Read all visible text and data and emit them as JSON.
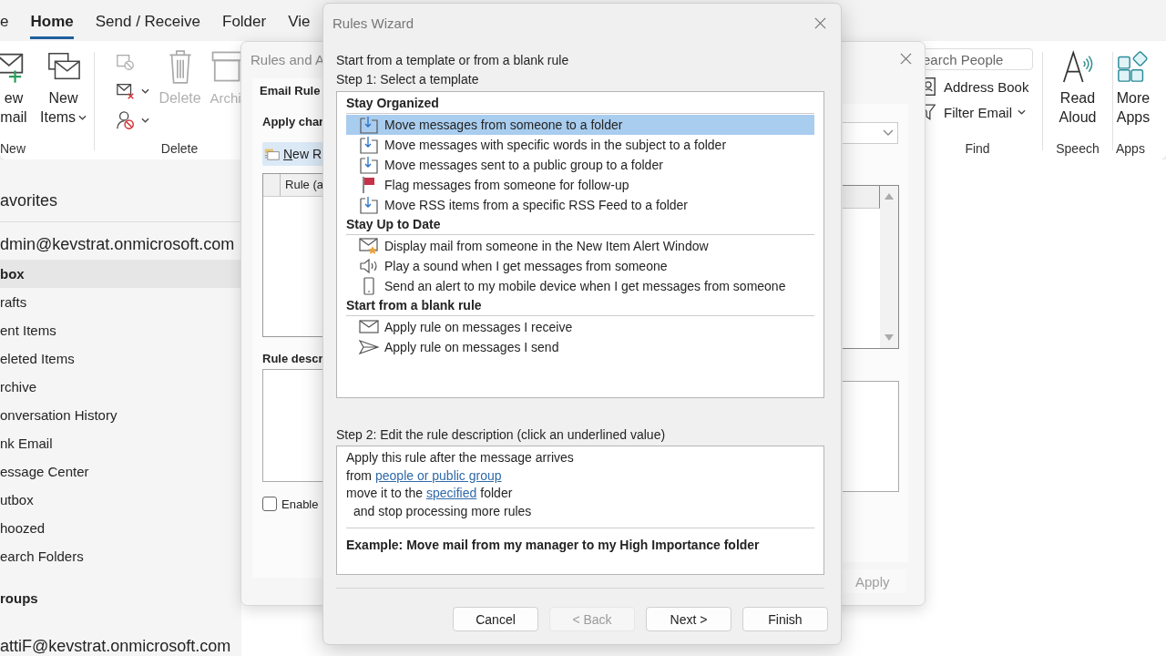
{
  "ribbon": {
    "tabs": [
      {
        "label": "e",
        "selected": false
      },
      {
        "label": "Home",
        "selected": true
      },
      {
        "label": "Send / Receive",
        "selected": false
      },
      {
        "label": "Folder",
        "selected": false
      },
      {
        "label": "Vie",
        "selected": false
      }
    ],
    "new_group": {
      "label": "New",
      "new_email": [
        "ew",
        "mail"
      ],
      "new_items": [
        "New",
        "Items"
      ]
    },
    "delete_group": {
      "label": "Delete",
      "delete": {
        "label": "Delete",
        "disabled": true
      },
      "archive": {
        "label": "Archi",
        "disabled": true
      }
    },
    "find_group": {
      "label": "Find",
      "search_placeholder": "earch People",
      "address_book": "Address Book",
      "filter_email": "Filter Email"
    },
    "speech_group": {
      "label": "Speech",
      "read_aloud": [
        "Read",
        "Aloud"
      ]
    },
    "apps_group": {
      "label": "Apps",
      "more_apps": [
        "More",
        "Apps"
      ]
    }
  },
  "navigation": {
    "favorites": "avorites",
    "account": "dmin@kevstrat.onmicrosoft.com",
    "folders": [
      {
        "label": "box",
        "selected": true
      },
      {
        "label": "rafts",
        "selected": false
      },
      {
        "label": "ent Items",
        "selected": false
      },
      {
        "label": "eleted Items",
        "selected": false
      },
      {
        "label": "rchive",
        "selected": false
      },
      {
        "label": "onversation History",
        "selected": false
      },
      {
        "label": "nk Email",
        "selected": false
      },
      {
        "label": "essage Center",
        "selected": false
      },
      {
        "label": "utbox",
        "selected": false
      },
      {
        "label": "hoozed",
        "selected": false
      },
      {
        "label": "earch Folders",
        "selected": false
      }
    ],
    "groups": "roups",
    "second_account": "attiF@kevstrat.onmicrosoft.com"
  },
  "rules_and_alerts": {
    "title": "Rules and A",
    "tab": "Email Rule",
    "apply_changes_label": "Apply char",
    "new_rule_button": "New R",
    "column_header": "Rule (a",
    "description_label": "Rule descr",
    "enable_checkbox": {
      "label": "Enable",
      "checked": false
    },
    "apply_button": {
      "label": "Apply",
      "disabled": true
    }
  },
  "rules_wizard": {
    "title": "Rules Wizard",
    "intro": "Start from a template or from a blank rule",
    "step1": "Step 1: Select a template",
    "template_groups": [
      {
        "heading": "Stay Organized",
        "items": [
          {
            "kind": "move",
            "label": "Move messages from someone to a folder",
            "selected": true
          },
          {
            "kind": "move",
            "label": "Move messages with specific words in the subject to a folder",
            "selected": false
          },
          {
            "kind": "move",
            "label": "Move messages sent to a public group to a folder",
            "selected": false
          },
          {
            "kind": "flag",
            "label": "Flag messages from someone for follow-up",
            "selected": false
          },
          {
            "kind": "move",
            "label": "Move RSS items from a specific RSS Feed to a folder",
            "selected": false
          }
        ]
      },
      {
        "heading": "Stay Up to Date",
        "items": [
          {
            "kind": "alert",
            "label": "Display mail from someone in the New Item Alert Window",
            "selected": false
          },
          {
            "kind": "sound",
            "label": "Play a sound when I get messages from someone",
            "selected": false
          },
          {
            "kind": "mobile",
            "label": "Send an alert to my mobile device when I get messages from someone",
            "selected": false
          }
        ]
      },
      {
        "heading": "Start from a blank rule",
        "items": [
          {
            "kind": "receive",
            "label": "Apply rule on messages I receive",
            "selected": false
          },
          {
            "kind": "send",
            "label": "Apply rule on messages I send",
            "selected": false
          }
        ]
      }
    ],
    "step2": "Step 2: Edit the rule description (click an underlined value)",
    "description_lines": [
      {
        "indented": false,
        "parts": [
          {
            "text": "Apply this rule after the message arrives",
            "link": false
          }
        ]
      },
      {
        "indented": false,
        "parts": [
          {
            "text": "from",
            "link": false
          },
          {
            "text": "people or public group",
            "link": true
          }
        ]
      },
      {
        "indented": false,
        "parts": [
          {
            "text": "move it to the",
            "link": false
          },
          {
            "text": "specified",
            "link": true
          },
          {
            "text": "folder",
            "link": false
          }
        ]
      },
      {
        "indented": true,
        "parts": [
          {
            "text": "and stop processing more rules",
            "link": false
          }
        ]
      }
    ],
    "example": "Example: Move mail from my manager to my High Importance folder",
    "buttons": [
      {
        "label": "Cancel",
        "disabled": false
      },
      {
        "label": "< Back",
        "disabled": true
      },
      {
        "label": "Next >",
        "disabled": false
      },
      {
        "label": "Finish",
        "disabled": false
      }
    ]
  }
}
